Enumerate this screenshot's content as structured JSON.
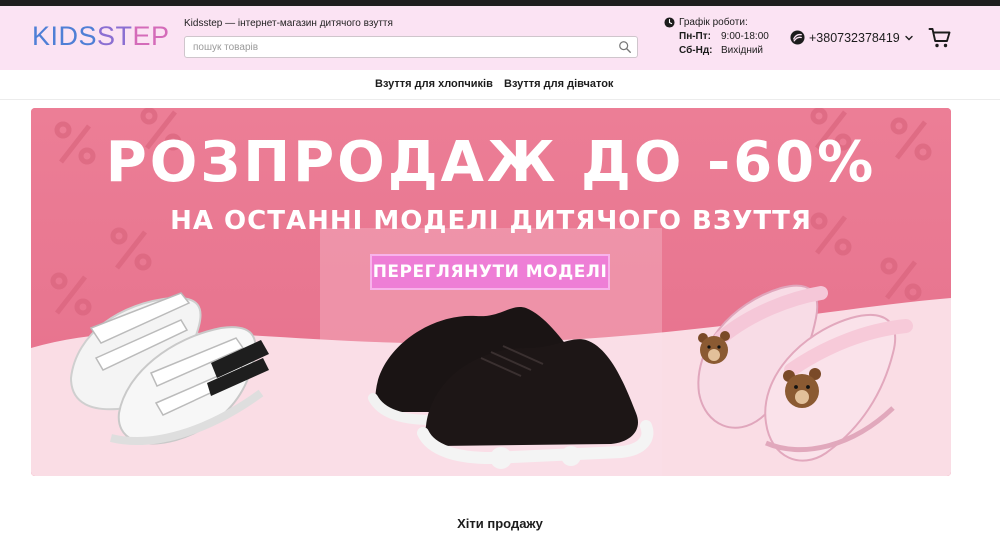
{
  "header": {
    "logo": {
      "part1": "KIDS",
      "part2": "ST",
      "part3": "EP"
    },
    "tagline": "Kidsstep — інтернет-магазин дитячого взуття",
    "search": {
      "placeholder": "пошук товарів",
      "value": ""
    },
    "schedule": {
      "title": "Графік роботи:",
      "rows": [
        {
          "days": "Пн-Пт:",
          "time": "9:00-18:00"
        },
        {
          "days": "Сб-Нд:",
          "time": "Вихідний"
        }
      ]
    },
    "phone": "+380732378419"
  },
  "nav": {
    "items": [
      {
        "label": "Взуття для хлопчиків"
      },
      {
        "label": "Взуття для дівчаток"
      }
    ]
  },
  "banner": {
    "headline": "РОЗПРОДАЖ ДО -60%",
    "subheadline": "НА ОСТАННІ МОДЕЛІ ДИТЯЧОГО ВЗУТТЯ",
    "cta_label": "ПЕРЕГЛЯНУТИ МОДЕЛІ",
    "images": [
      "white-sandals",
      "black-sneakers",
      "pink-bear-sandals"
    ]
  },
  "bestsellers": {
    "title": "Хіти продажу"
  },
  "colors": {
    "header_bg": "#fbe3f3",
    "banner_bg": "#e8748f",
    "cta_bg": "#ee7ed6",
    "logo_blue": "#4f7fd6",
    "logo_purple": "#8b6fd2",
    "logo_pink": "#d46bb9"
  }
}
